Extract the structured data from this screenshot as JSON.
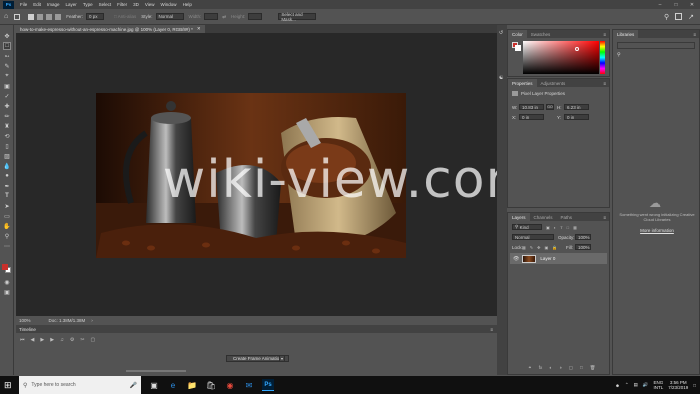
{
  "menubar": {
    "logo": "Ps",
    "items": [
      "File",
      "Edit",
      "Image",
      "Layer",
      "Type",
      "Select",
      "Filter",
      "3D",
      "View",
      "Window",
      "Help"
    ]
  },
  "options_bar": {
    "feather_label": "Feather:",
    "feather_value": "0 px",
    "style_label": "Style:",
    "style_value": "Normal",
    "width_label": "Width:",
    "height_label": "Height:",
    "select_mask_button": "Select and Mask..."
  },
  "document": {
    "tab_title": "how-to-make-espresso-without-an-espresso-machine.jpg @ 100% (Layer 0, RGB/8#) *",
    "zoom": "100%",
    "doc_size": "Doc: 1.38M/1.38M"
  },
  "timeline": {
    "title": "Timeline",
    "create_button": "Create Frame Animation"
  },
  "watermark": "wiki-view.com",
  "color_panel": {
    "tabs": [
      "Color",
      "Swatches"
    ],
    "fg_color": "#c8302c",
    "bg_color": "#ffffff"
  },
  "properties_panel": {
    "tabs": [
      "Properties",
      "Adjustments"
    ],
    "section_title": "Pixel Layer Properties",
    "w_label": "W:",
    "w_value": "10.83 in",
    "h_label": "H:",
    "h_value": "6.23 in",
    "go_label": "GO",
    "x_label": "X:",
    "x_value": "0 in",
    "y_label": "Y:",
    "y_value": "0 in"
  },
  "layers_panel": {
    "tabs": [
      "Layers",
      "Channels",
      "Paths"
    ],
    "kind_label": "Kind",
    "blend_mode": "Normal",
    "opacity_label": "Opacity:",
    "opacity_value": "100%",
    "lock_label": "Lock:",
    "fill_label": "Fill:",
    "fill_value": "100%",
    "layer_name": "Layer 0"
  },
  "libraries_panel": {
    "title": "Libraries",
    "message": "Something went wrong initializing Creative Cloud Libraries",
    "more_info": "More information"
  },
  "taskbar": {
    "search_placeholder": "Type here to search",
    "language": "ENG",
    "language_sub": "INTL",
    "time": "3:56 PM",
    "date": "7/23/2019"
  }
}
